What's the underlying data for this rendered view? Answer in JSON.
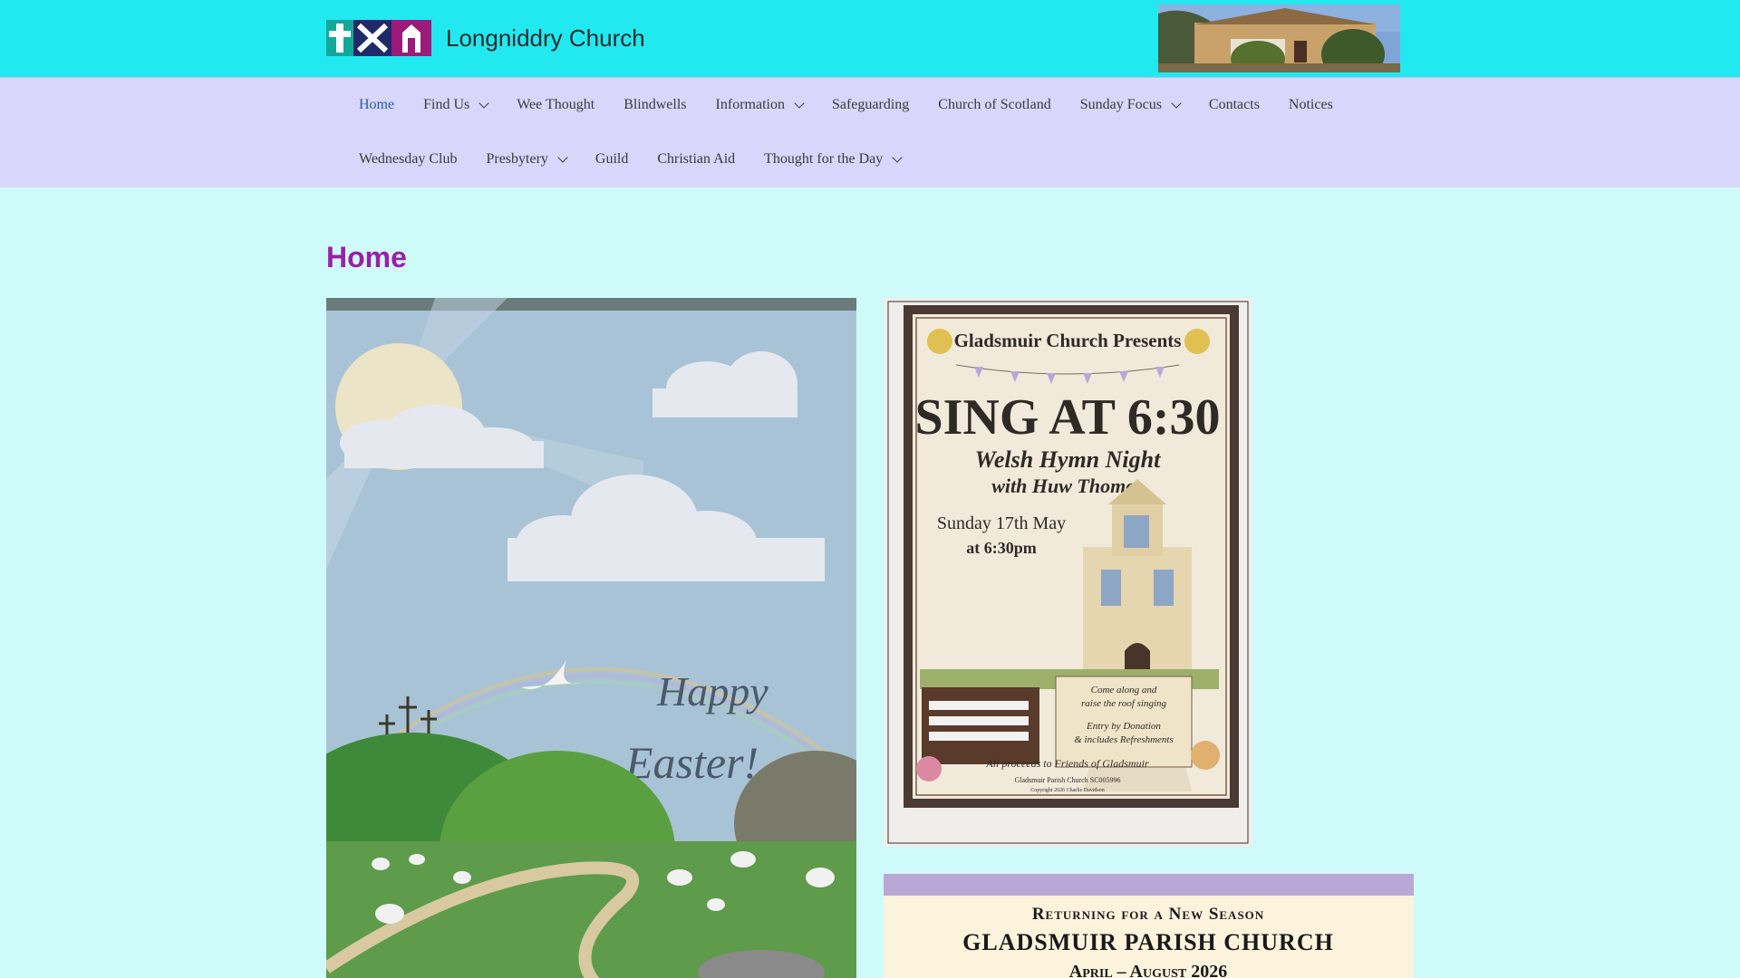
{
  "site": {
    "title": "Longniddry Church"
  },
  "nav": {
    "row1": [
      {
        "label": "Home",
        "active": true,
        "dropdown": false
      },
      {
        "label": "Find Us",
        "dropdown": true
      },
      {
        "label": "Wee Thought",
        "dropdown": false
      },
      {
        "label": "Blindwells",
        "dropdown": false
      },
      {
        "label": "Information",
        "dropdown": true
      },
      {
        "label": "Safeguarding",
        "dropdown": false
      },
      {
        "label": "Church of Scotland",
        "dropdown": false
      },
      {
        "label": "Sunday Focus",
        "dropdown": true
      },
      {
        "label": "Contacts",
        "dropdown": false
      },
      {
        "label": "Notices",
        "dropdown": false
      }
    ],
    "row2": [
      {
        "label": "Wednesday Club",
        "dropdown": false
      },
      {
        "label": "Presbytery",
        "dropdown": true
      },
      {
        "label": "Guild",
        "dropdown": false
      },
      {
        "label": "Christian Aid",
        "dropdown": false
      },
      {
        "label": "Thought for the Day",
        "dropdown": true
      }
    ]
  },
  "page": {
    "title": "Home"
  },
  "easter_card": {
    "line1": "Happy",
    "line2": "Easter!"
  },
  "sing_poster": {
    "presenter": "Gladsmuir Church Presents",
    "headline": "SING AT 6:30",
    "subtitle1": "Welsh Hymn Night",
    "subtitle2": "with Huw Thomas",
    "date": "Sunday 17th May",
    "time": "at 6:30pm",
    "note1": "Come along and",
    "note2": "raise the roof singing",
    "note3": "Entry by Donation",
    "note4": "& includes Refreshments",
    "proceeds": "All proceeds to Friends of Gladsmuir",
    "charity": "Gladsmuir Parish Church SC005996",
    "copyright": "Copyright 2026 Charlie Davidson"
  },
  "season_poster": {
    "line1": "Returning for a New Season",
    "line2": "GLADSMUIR PARISH CHURCH",
    "line3": "April – August 2026"
  },
  "colors": {
    "header_bg": "#22e8f0",
    "nav_bg": "#d8d6fb",
    "page_bg": "#cffafa",
    "title_color": "#9b1fa6",
    "active_link": "#1e5faa"
  }
}
